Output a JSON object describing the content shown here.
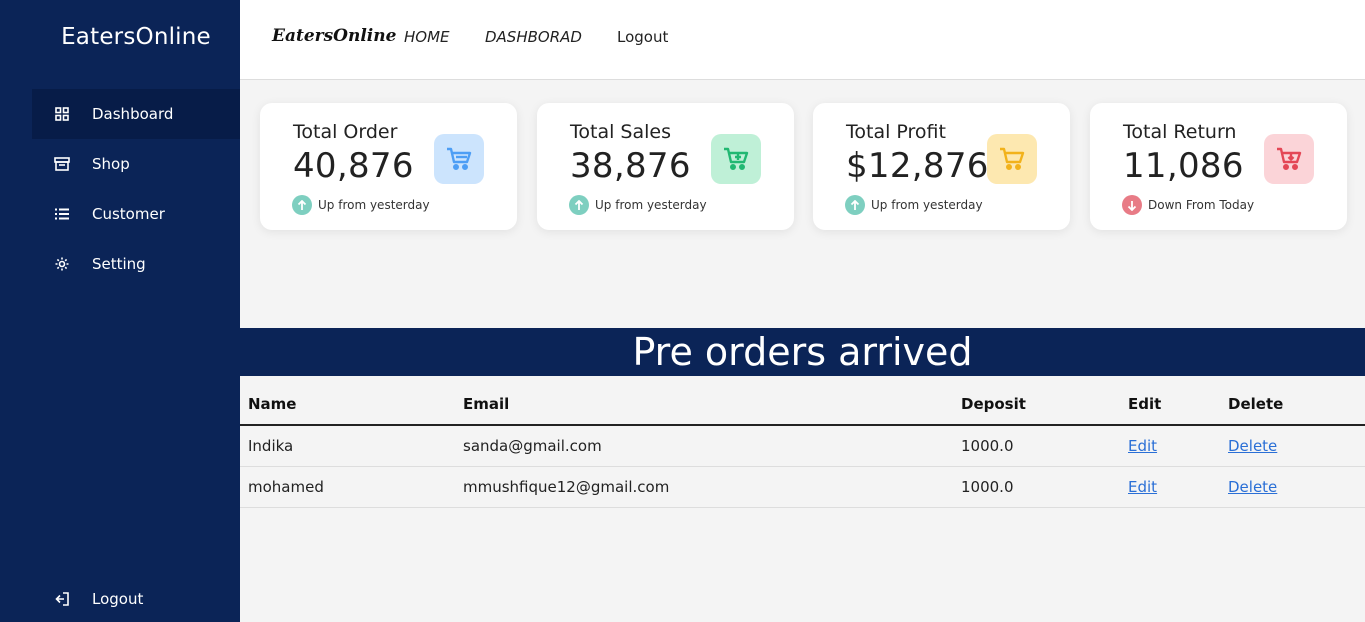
{
  "sidebar": {
    "brand": "EatersOnline",
    "items": [
      {
        "label": "Dashboard",
        "icon": "grid-icon"
      },
      {
        "label": "Shop",
        "icon": "store-icon"
      },
      {
        "label": "Customer",
        "icon": "list-icon"
      },
      {
        "label": "Setting",
        "icon": "gear-icon"
      }
    ],
    "logout": {
      "label": "Logout",
      "icon": "logout-icon"
    }
  },
  "topbar": {
    "logo": "EatersOnline",
    "links": [
      "HOME",
      "DASHBORAD",
      "Logout"
    ]
  },
  "cards": [
    {
      "title": "Total Order",
      "value": "40,876",
      "trend": "Up from yesterday",
      "direction": "up",
      "icon_bg": "#cce4fd",
      "icon_color": "#4d9ef5"
    },
    {
      "title": "Total Sales",
      "value": "38,876",
      "trend": "Up from yesterday",
      "direction": "up",
      "icon_bg": "#bff0d7",
      "icon_color": "#21b872"
    },
    {
      "title": "Total Profit",
      "value": "$12,876",
      "trend": "Up from yesterday",
      "direction": "up",
      "icon_bg": "#fde8b0",
      "icon_color": "#f2b21b"
    },
    {
      "title": "Total Return",
      "value": "11,086",
      "trend": "Down From Today",
      "direction": "down",
      "icon_bg": "#fbd4d8",
      "icon_color": "#e44756"
    }
  ],
  "colors": {
    "sidebar": "#0b2457",
    "up": "#7ecfc0",
    "down": "#e87b86",
    "link": "#2a6fd6"
  },
  "banner": "Pre orders arrived",
  "table": {
    "headers": [
      "Name",
      "Email",
      "Deposit",
      "Edit",
      "Delete"
    ],
    "rows": [
      {
        "name": "Indika",
        "email": "sanda@gmail.com",
        "deposit": "1000.0",
        "edit": "Edit",
        "delete": "Delete"
      },
      {
        "name": "mohamed",
        "email": "mmushfique12@gmail.com",
        "deposit": "1000.0",
        "edit": "Edit",
        "delete": "Delete"
      }
    ]
  }
}
